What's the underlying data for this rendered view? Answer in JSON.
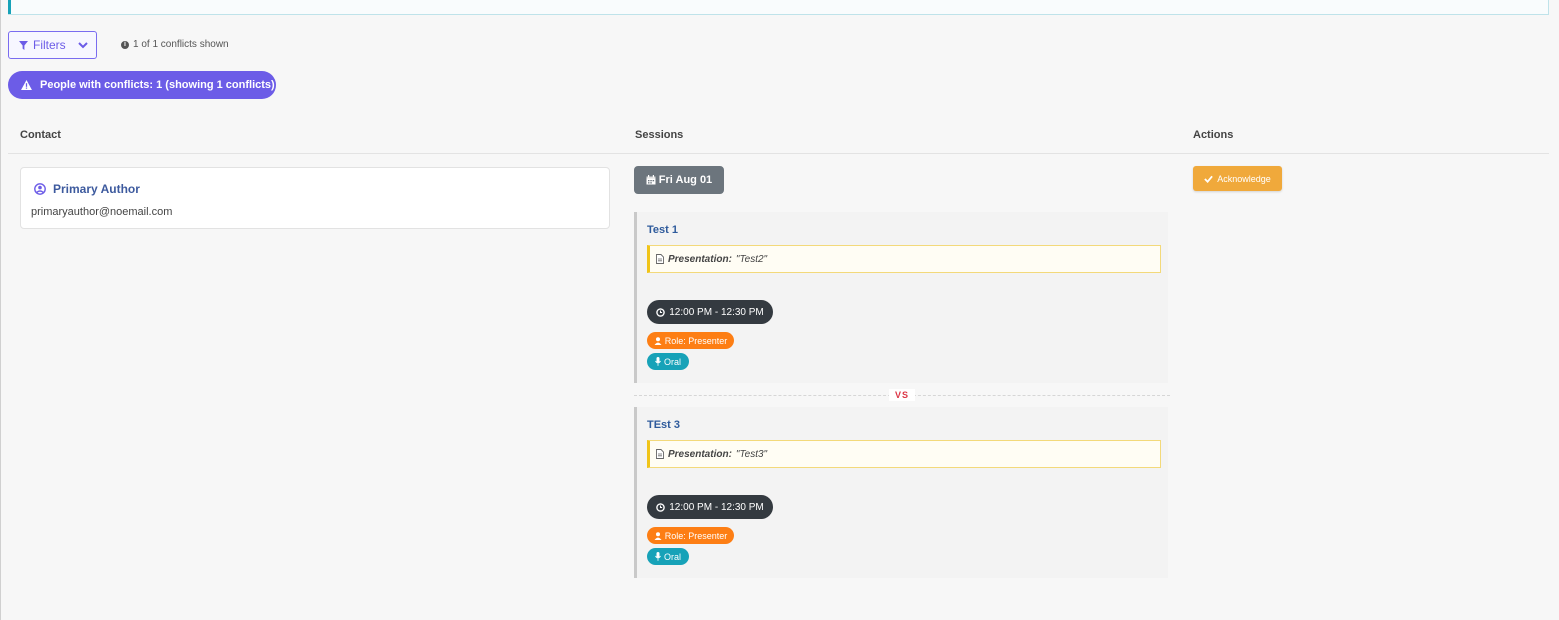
{
  "toolbar": {
    "filters_label": "Filters",
    "conflicts_shown": "1 of 1 conflicts shown"
  },
  "alert": {
    "text": "People with conflicts: 1 (showing 1 conflicts)"
  },
  "table": {
    "headers": [
      "Contact",
      "Sessions",
      "Actions"
    ]
  },
  "contact": {
    "name": "Primary Author",
    "email": "primaryauthor@noemail.com"
  },
  "date": "Fri Aug 01",
  "sessions": [
    {
      "title": "Test 1",
      "presentation_label": "Presentation:",
      "presentation_value": "\"Test2\"",
      "time": "12:00 PM - 12:30 PM",
      "role": "Role: Presenter",
      "type": "Oral"
    },
    {
      "title": "TEst 3",
      "presentation_label": "Presentation:",
      "presentation_value": "\"Test3\"",
      "time": "12:00 PM - 12:30 PM",
      "role": "Role: Presenter",
      "type": "Oral"
    }
  ],
  "vs_label": "VS",
  "actions": {
    "acknowledge_label": "Acknowledge"
  },
  "colors": {
    "accent_purple": "#6c5ce7",
    "date_badge": "#6c757d",
    "time_pill": "#343a40",
    "role_pill": "#fd7e14",
    "type_pill": "#17a2b8",
    "acknowledge": "#f0a93b",
    "vs": "#dc3545"
  }
}
